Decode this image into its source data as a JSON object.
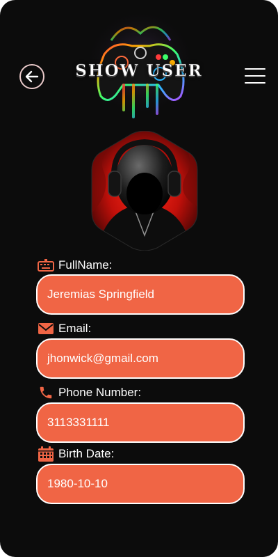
{
  "header": {
    "title": "SHOW USER",
    "back_icon": "arrow-left-circle-icon",
    "menu_icon": "hamburger-menu-icon"
  },
  "profile": {
    "avatar_description_icon": "user-avatar-headphones"
  },
  "fields": [
    {
      "label": "FullName:",
      "value": "Jeremias Springfield",
      "icon": "keyboard-icon"
    },
    {
      "label": "Email:",
      "value": "jhonwick@gmail.com",
      "icon": "envelope-icon"
    },
    {
      "label": "Phone Number:",
      "value": "3113331111",
      "icon": "phone-icon"
    },
    {
      "label": "Birth Date:",
      "value": "1980-10-10",
      "icon": "calendar-icon"
    }
  ],
  "colors": {
    "background": "#0c0c0c",
    "accent": "#f06545",
    "text": "#ffffff"
  }
}
